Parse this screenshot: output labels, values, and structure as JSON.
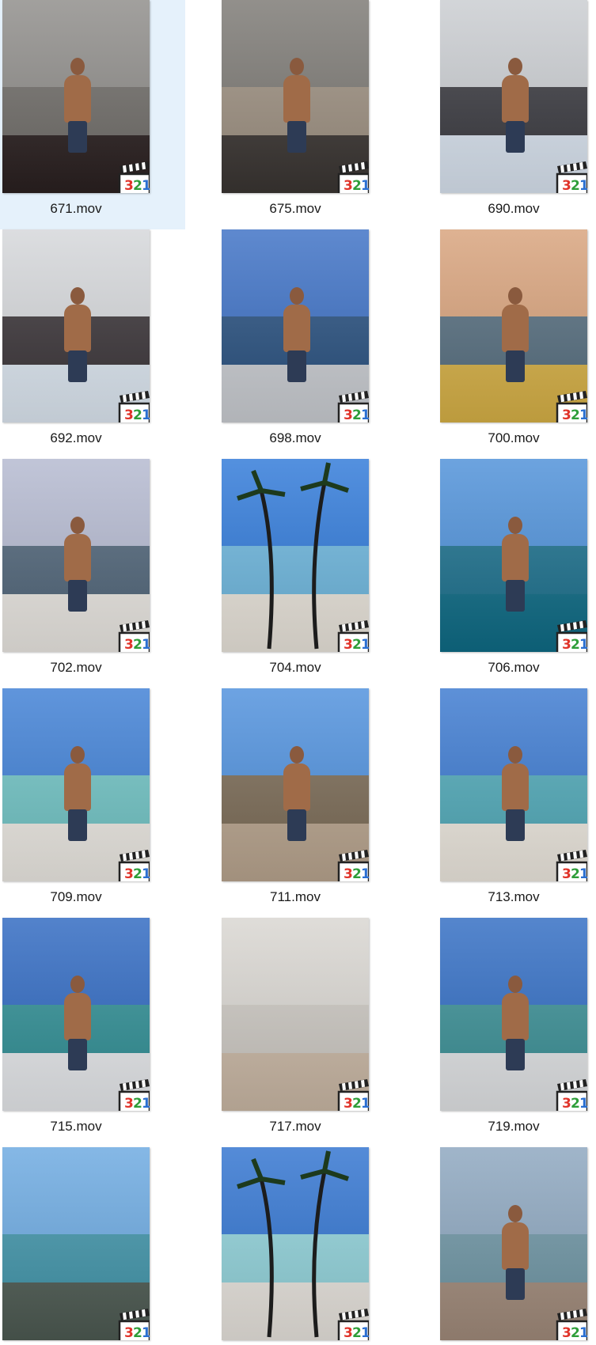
{
  "files": [
    {
      "name": "671.mov",
      "selected": true,
      "scene": "indoor-shoes",
      "colors": {
        "sky": "#8d8b88",
        "mid": "#6f6c68",
        "ground": "#2a2020"
      }
    },
    {
      "name": "675.mov",
      "selected": false,
      "scene": "bathroom",
      "colors": {
        "sky": "#7a7772",
        "mid": "#9c8f80",
        "ground": "#3a3532"
      }
    },
    {
      "name": "690.mov",
      "selected": false,
      "scene": "car-selfie",
      "colors": {
        "sky": "#c9ccd0",
        "mid": "#3a3a40",
        "ground": "#d8e2ee"
      }
    },
    {
      "name": "692.mov",
      "selected": false,
      "scene": "car-selfie",
      "colors": {
        "sky": "#d4d6d9",
        "mid": "#3a3438",
        "ground": "#dce6f0"
      }
    },
    {
      "name": "698.mov",
      "selected": false,
      "scene": "boat-sky",
      "colors": {
        "sky": "#3b6fc4",
        "mid": "#28507f",
        "ground": "#c9ccd1"
      }
    },
    {
      "name": "700.mov",
      "selected": false,
      "scene": "sunset-sea",
      "colors": {
        "sky": "#d7a17a",
        "mid": "#556d7e",
        "ground": "#d6b046"
      }
    },
    {
      "name": "702.mov",
      "selected": false,
      "scene": "sunset-boat",
      "colors": {
        "sky": "#b3b8cf",
        "mid": "#4f6478",
        "ground": "#e9e6e1"
      }
    },
    {
      "name": "704.mov",
      "selected": false,
      "scene": "palm-beach",
      "colors": {
        "sky": "#2e78d8",
        "mid": "#6cb5dc",
        "ground": "#e8e3da"
      }
    },
    {
      "name": "706.mov",
      "selected": false,
      "scene": "ocean-swim",
      "colors": {
        "sky": "#4c8fd8",
        "mid": "#1b6f8c",
        "ground": "#0e6b85"
      }
    },
    {
      "name": "709.mov",
      "selected": false,
      "scene": "beach",
      "colors": {
        "sky": "#3d7ed4",
        "mid": "#6fc2c3",
        "ground": "#ebe8e2"
      }
    },
    {
      "name": "711.mov",
      "selected": false,
      "scene": "hammock",
      "colors": {
        "sky": "#4d8fdc",
        "mid": "#7a6a55",
        "ground": "#b8a48e"
      }
    },
    {
      "name": "713.mov",
      "selected": false,
      "scene": "beach-flag",
      "colors": {
        "sky": "#3a78cf",
        "mid": "#4fa8b7",
        "ground": "#ece7de"
      }
    },
    {
      "name": "715.mov",
      "selected": false,
      "scene": "boat-sea",
      "colors": {
        "sky": "#2d67c0",
        "mid": "#2f8e94",
        "ground": "#e5e7ea"
      }
    },
    {
      "name": "717.mov",
      "selected": false,
      "scene": "sand",
      "colors": {
        "sky": "#d8d5d0",
        "mid": "#cbc7c1",
        "ground": "#c9b7a4"
      }
    },
    {
      "name": "719.mov",
      "selected": false,
      "scene": "boat-sea",
      "colors": {
        "sky": "#2f6bc2",
        "mid": "#3a8f95",
        "ground": "#e0e2e4"
      }
    },
    {
      "name": "",
      "selected": false,
      "scene": "reef",
      "colors": {
        "sky": "#6aa8e0",
        "mid": "#3f93a8",
        "ground": "#4d5a52"
      }
    },
    {
      "name": "",
      "selected": false,
      "scene": "beach-umbrella",
      "colors": {
        "sky": "#2f72cf",
        "mid": "#8fd0d8",
        "ground": "#e6e2dc"
      }
    },
    {
      "name": "",
      "selected": false,
      "scene": "evening-beach",
      "colors": {
        "sky": "#8ba5be",
        "mid": "#6d94a3",
        "ground": "#a08a7a"
      }
    }
  ],
  "badge": {
    "label": "321",
    "colors": {
      "red": "#e0342a",
      "green": "#2f9e3a",
      "blue": "#2a6fd1"
    }
  }
}
